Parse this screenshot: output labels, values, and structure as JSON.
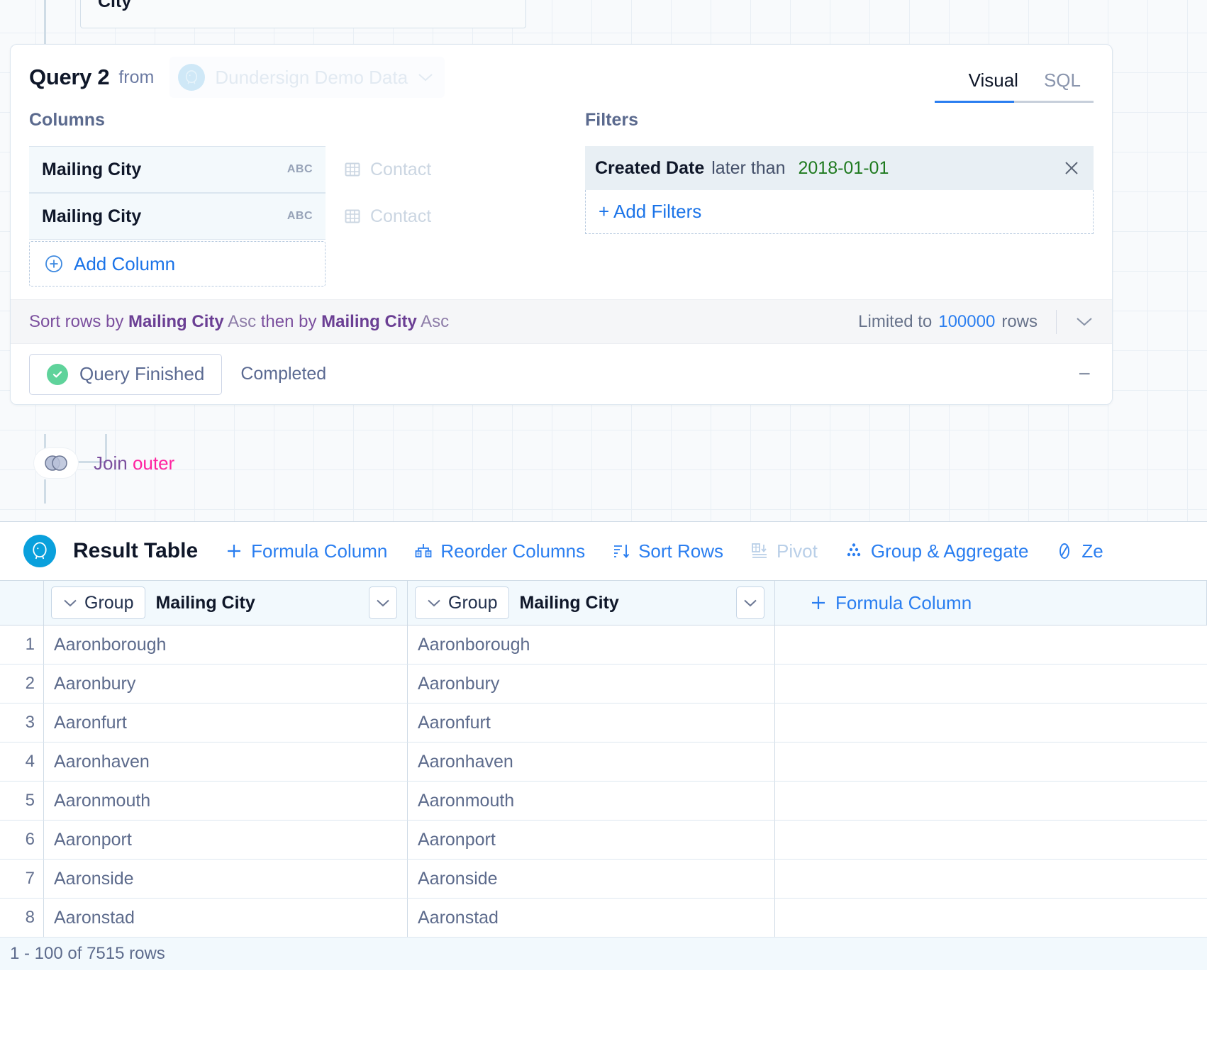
{
  "canvas": {
    "partial_card_text": "City"
  },
  "query_card": {
    "title": "Query 2",
    "from_label": "from",
    "datasource": "Dundersign Demo Data",
    "tabs": [
      {
        "label": "Visual",
        "active": true
      },
      {
        "label": "SQL",
        "active": false
      }
    ],
    "columns_section": {
      "label": "Columns",
      "items": [
        {
          "name": "Mailing City",
          "type": "ABC",
          "source": "Contact"
        },
        {
          "name": "Mailing City",
          "type": "ABC",
          "source": "Contact"
        }
      ],
      "add_column_label": "Add Column"
    },
    "filters_section": {
      "label": "Filters",
      "items": [
        {
          "field": "Created Date",
          "operator": "later than",
          "value": "2018-01-01"
        }
      ],
      "add_filters_label": "+ Add Filters"
    },
    "sort_bar": {
      "prefix": "Sort rows by",
      "sort1_field": "Mailing City",
      "sort1_dir": "Asc",
      "middle": "then by",
      "sort2_field": "Mailing City",
      "sort2_dir": "Asc",
      "limit_prefix": "Limited to",
      "limit_value": "100000",
      "limit_suffix": "rows"
    },
    "status": {
      "pill_label": "Query Finished",
      "sub_label": "Completed",
      "collapse_glyph": "−"
    }
  },
  "join": {
    "label_prefix": "Join",
    "label_type": "outer"
  },
  "result_table": {
    "title": "Result Table",
    "actions": [
      {
        "label": "Formula Column",
        "icon": "plus-icon",
        "disabled": false
      },
      {
        "label": "Reorder Columns",
        "icon": "reorder-icon",
        "disabled": false
      },
      {
        "label": "Sort Rows",
        "icon": "sort-icon",
        "disabled": false
      },
      {
        "label": "Pivot",
        "icon": "pivot-icon",
        "disabled": true
      },
      {
        "label": "Group & Aggregate",
        "icon": "group-icon",
        "disabled": false
      },
      {
        "label": "Ze",
        "icon": "zero-icon",
        "disabled": false
      }
    ],
    "columns": [
      {
        "group_label": "Group",
        "name": "Mailing City"
      },
      {
        "group_label": "Group",
        "name": "Mailing City"
      }
    ],
    "formula_column_label": "Formula Column",
    "rows": [
      {
        "index": "1",
        "c1": "Aaronborough",
        "c2": "Aaronborough"
      },
      {
        "index": "2",
        "c1": "Aaronbury",
        "c2": "Aaronbury"
      },
      {
        "index": "3",
        "c1": "Aaronfurt",
        "c2": "Aaronfurt"
      },
      {
        "index": "4",
        "c1": "Aaronhaven",
        "c2": "Aaronhaven"
      },
      {
        "index": "5",
        "c1": "Aaronmouth",
        "c2": "Aaronmouth"
      },
      {
        "index": "6",
        "c1": "Aaronport",
        "c2": "Aaronport"
      },
      {
        "index": "7",
        "c1": "Aaronside",
        "c2": "Aaronside"
      },
      {
        "index": "8",
        "c1": "Aaronstad",
        "c2": "Aaronstad"
      }
    ],
    "footer": "1 - 100 of 7515 rows"
  },
  "colors": {
    "accent_blue": "#2a7ef0",
    "link_blue": "#1a73e8",
    "purple": "#7b4f9e",
    "pink": "#ff23a0",
    "green_value": "#1f7a1f",
    "success_green": "#5fd39b",
    "pg_logo": "#0aa0dc"
  }
}
